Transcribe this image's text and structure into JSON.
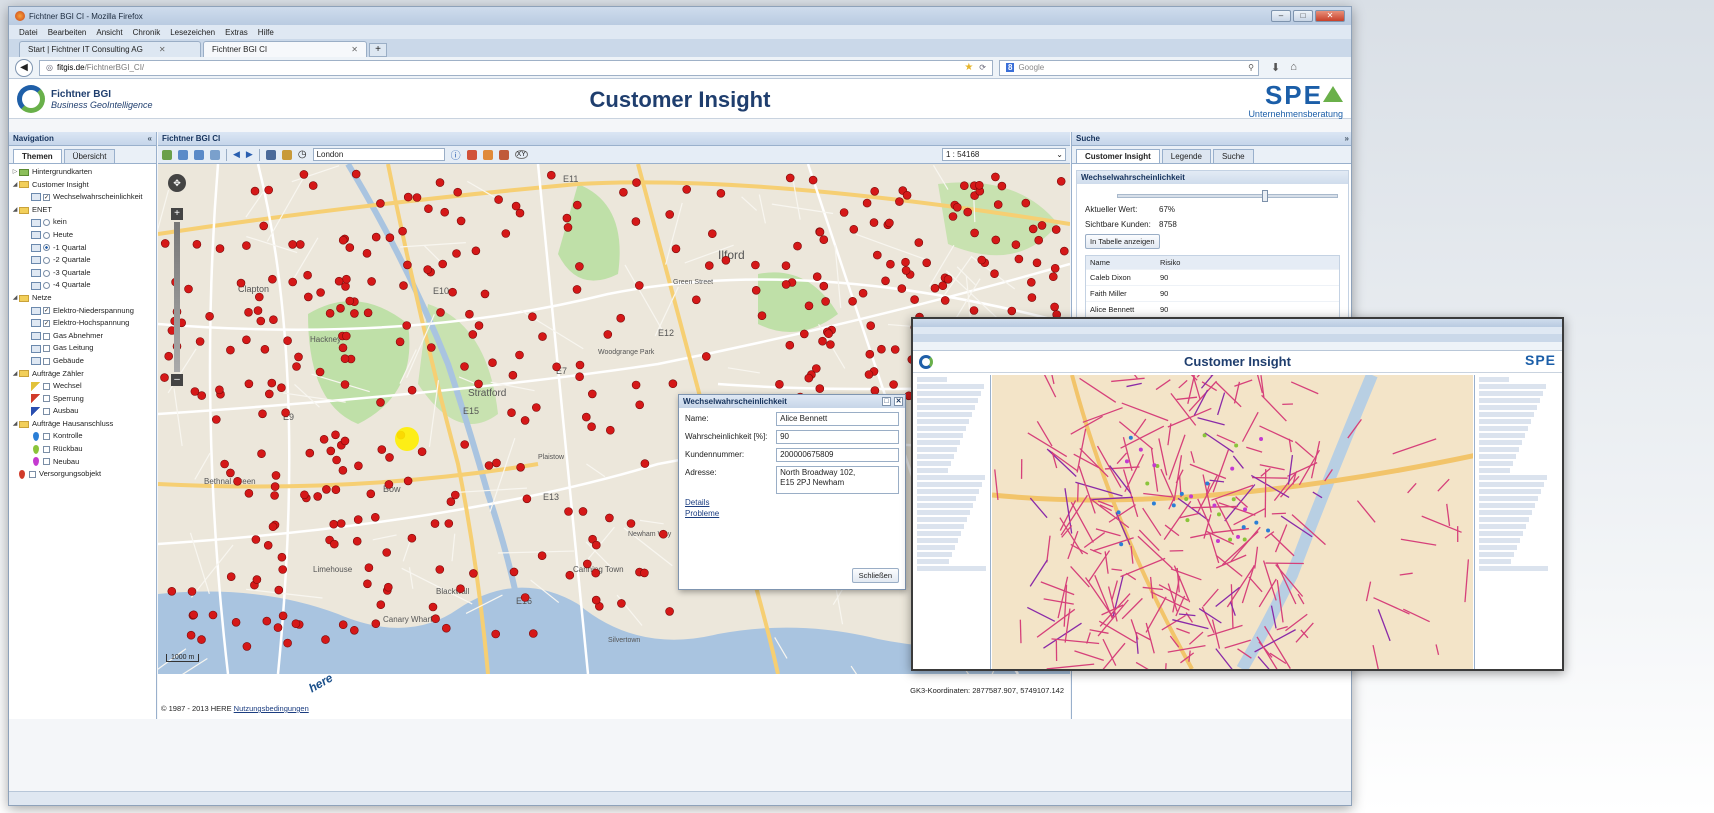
{
  "browser": {
    "window_title": "Fichtner BGI CI - Mozilla Firefox",
    "menu": [
      "Datei",
      "Bearbeiten",
      "Ansicht",
      "Chronik",
      "Lesezeichen",
      "Extras",
      "Hilfe"
    ],
    "tabs": [
      {
        "label": "Start | Fichtner IT Consulting AG"
      },
      {
        "label": "Fichtner BGI CI"
      }
    ],
    "url_host": "fitgis.de",
    "url_path": "/FichtnerBGI_CI/",
    "search_placeholder": "Google"
  },
  "header": {
    "logo_line1": "Fichtner BGI",
    "logo_line2": "Business GeoIntelligence",
    "title": "Customer Insight",
    "brand": "SPE",
    "brand_sub": "Unternehmensberatung"
  },
  "navigation": {
    "title": "Navigation",
    "tabs": [
      "Themen",
      "Übersicht"
    ],
    "tree": {
      "hintergrund": "Hintergrundkarten",
      "customer_insight": "Customer Insight",
      "wechsel": "Wechselwahrscheinlichkeit",
      "enet": "ENET",
      "kein": "kein",
      "heute": "Heute",
      "q1": "-1 Quartal",
      "q2": "-2 Quartale",
      "q3": "-3 Quartale",
      "q4": "-4 Quartale",
      "netze": "Netze",
      "elektro_nieder": "Elektro-Niederspannung",
      "elektro_hoch": "Elektro-Hochspannung",
      "gas_abnehmer": "Gas Abnehmer",
      "gas_leitung": "Gas Leitung",
      "gebaeude": "Gebäude",
      "auftraege_zaehler": "Aufträge Zähler",
      "wechsel2": "Wechsel",
      "sperrung": "Sperrung",
      "ausbau": "Ausbau",
      "auftraege_haus": "Aufträge Hausanschluss",
      "kontrolle": "Kontrolle",
      "rueckbau": "Rückbau",
      "neubau": "Neubau",
      "versorgung": "Versorgungsobjekt"
    }
  },
  "map_panel": {
    "title": "Fichtner BGI CI",
    "search_value": "London",
    "scale": "1 : 54168",
    "copyright": "© 1987 - 2013 HERE",
    "terms": "Nutzungsbedingungen",
    "here": "here",
    "coords": "GK3-Koordinaten: 2877587.907, 5749107.142",
    "scale_bar": "1000 m",
    "labels": {
      "ilford": "Ilford",
      "stratford": "Stratford",
      "bow": "Bow",
      "e10": "E10",
      "e15": "E15",
      "e12": "E12",
      "e13": "E13",
      "e9": "E9",
      "e7": "E7",
      "e11": "E11",
      "e16": "E16",
      "clapton": "Clapton",
      "hackney": "Hackney",
      "bethnal": "Bethnal Green",
      "limehouse": "Limehouse",
      "canary": "Canary Wharf",
      "plaistow": "Plaistow",
      "canning": "Canning Town",
      "silvertown": "Silvertown",
      "blackwall": "Blackwall",
      "newham": "Newham Way",
      "green_st": "Green Street",
      "woodgrange": "Woodgrange Park"
    }
  },
  "popup": {
    "title": "Wechselwahrscheinlichkeit",
    "name_label": "Name:",
    "name_value": "Alice Bennett",
    "prob_label": "Wahrscheinlichkeit [%]:",
    "prob_value": "90",
    "kunde_label": "Kundennummer:",
    "kunde_value": "200000675809",
    "adresse_label": "Adresse:",
    "adresse_value": "North Broadway 102,\nE15 2PJ Newham",
    "link_details": "Details",
    "link_probleme": "Probleme",
    "close": "Schließen"
  },
  "right": {
    "title": "Suche",
    "tabs": [
      "Customer Insight",
      "Legende",
      "Suche"
    ],
    "section": "Wechselwahrscheinlichkeit",
    "slider_fraction": 0.67,
    "aktueller_label": "Aktueller Wert:",
    "aktueller_value": "67%",
    "kunden_label": "Sichtbare Kunden:",
    "kunden_value": "8758",
    "table_button": "In Tabelle anzeigen",
    "col_name": "Name",
    "col_risiko": "Risiko",
    "rows": [
      {
        "name": "Caleb Dixon",
        "risk": "90"
      },
      {
        "name": "Faith Miller",
        "risk": "90"
      },
      {
        "name": "Alice Bennett",
        "risk": "90"
      }
    ]
  },
  "inset": {
    "title": "Customer Insight",
    "brand": "SPE"
  },
  "colors": {
    "marker": "#d51818",
    "highlight": "#ffee00",
    "title_blue": "#1f3e6e"
  }
}
